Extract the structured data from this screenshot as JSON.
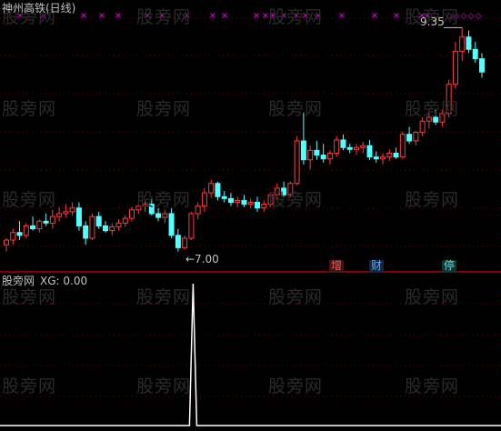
{
  "upper_panel": {
    "title": "神州高铁(日线)",
    "high_label": "9.35",
    "low_label": "←7.00",
    "tags": [
      {
        "text": "增",
        "color": "#ff5555",
        "bg": "#3a1818"
      },
      {
        "text": "财",
        "color": "#55aaff",
        "bg": "#14243a"
      },
      {
        "text": "停",
        "color": "#55dddd",
        "bg": "#113333"
      }
    ],
    "x_marker_glyph": "×",
    "diamond_glyph": "◇"
  },
  "lower_panel": {
    "name": "股旁网",
    "indicator": "XG: 0.00",
    "peak_value": 1
  },
  "watermark": "股旁网",
  "colors": {
    "up": "#ff3c3c",
    "down": "#54ffff",
    "grid": "#7a0000",
    "divider": "#b00000",
    "marker": "#ff00ff",
    "text": "#c0c0c0",
    "peak_line": "#ffffff"
  },
  "chart_data": {
    "type": "candlestick",
    "price_range": [
      6.85,
      9.45
    ],
    "candles": [
      {
        "o": 7.05,
        "h": 7.12,
        "l": 6.98,
        "c": 7.1
      },
      {
        "o": 7.1,
        "h": 7.22,
        "l": 7.05,
        "c": 7.18
      },
      {
        "o": 7.18,
        "h": 7.3,
        "l": 7.1,
        "c": 7.15
      },
      {
        "o": 7.15,
        "h": 7.28,
        "l": 7.12,
        "c": 7.25
      },
      {
        "o": 7.25,
        "h": 7.35,
        "l": 7.2,
        "c": 7.22
      },
      {
        "o": 7.22,
        "h": 7.32,
        "l": 7.18,
        "c": 7.3
      },
      {
        "o": 7.3,
        "h": 7.38,
        "l": 7.25,
        "c": 7.28
      },
      {
        "o": 7.28,
        "h": 7.42,
        "l": 7.22,
        "c": 7.35
      },
      {
        "o": 7.35,
        "h": 7.45,
        "l": 7.3,
        "c": 7.38
      },
      {
        "o": 7.38,
        "h": 7.48,
        "l": 7.34,
        "c": 7.4
      },
      {
        "o": 7.4,
        "h": 7.5,
        "l": 7.36,
        "c": 7.44
      },
      {
        "o": 7.44,
        "h": 7.5,
        "l": 7.2,
        "c": 7.25
      },
      {
        "o": 7.25,
        "h": 7.3,
        "l": 7.05,
        "c": 7.12
      },
      {
        "o": 7.12,
        "h": 7.38,
        "l": 7.1,
        "c": 7.35
      },
      {
        "o": 7.35,
        "h": 7.4,
        "l": 7.22,
        "c": 7.25
      },
      {
        "o": 7.25,
        "h": 7.3,
        "l": 7.18,
        "c": 7.2
      },
      {
        "o": 7.2,
        "h": 7.28,
        "l": 7.15,
        "c": 7.24
      },
      {
        "o": 7.24,
        "h": 7.32,
        "l": 7.2,
        "c": 7.28
      },
      {
        "o": 7.28,
        "h": 7.36,
        "l": 7.24,
        "c": 7.33
      },
      {
        "o": 7.33,
        "h": 7.45,
        "l": 7.3,
        "c": 7.42
      },
      {
        "o": 7.42,
        "h": 7.5,
        "l": 7.38,
        "c": 7.46
      },
      {
        "o": 7.46,
        "h": 7.52,
        "l": 7.4,
        "c": 7.48
      },
      {
        "o": 7.48,
        "h": 7.54,
        "l": 7.36,
        "c": 7.38
      },
      {
        "o": 7.38,
        "h": 7.44,
        "l": 7.3,
        "c": 7.34
      },
      {
        "o": 7.34,
        "h": 7.42,
        "l": 7.28,
        "c": 7.38
      },
      {
        "o": 7.38,
        "h": 7.44,
        "l": 7.12,
        "c": 7.15
      },
      {
        "o": 7.15,
        "h": 7.22,
        "l": 6.98,
        "c": 7.02
      },
      {
        "o": 7.02,
        "h": 7.15,
        "l": 7.0,
        "c": 7.12
      },
      {
        "o": 7.12,
        "h": 7.4,
        "l": 7.1,
        "c": 7.38
      },
      {
        "o": 7.38,
        "h": 7.5,
        "l": 7.32,
        "c": 7.46
      },
      {
        "o": 7.46,
        "h": 7.65,
        "l": 7.4,
        "c": 7.6
      },
      {
        "o": 7.6,
        "h": 7.74,
        "l": 7.55,
        "c": 7.7
      },
      {
        "o": 7.7,
        "h": 7.72,
        "l": 7.52,
        "c": 7.56
      },
      {
        "o": 7.56,
        "h": 7.62,
        "l": 7.5,
        "c": 7.54
      },
      {
        "o": 7.54,
        "h": 7.6,
        "l": 7.46,
        "c": 7.5
      },
      {
        "o": 7.5,
        "h": 7.56,
        "l": 7.45,
        "c": 7.52
      },
      {
        "o": 7.52,
        "h": 7.58,
        "l": 7.45,
        "c": 7.48
      },
      {
        "o": 7.48,
        "h": 7.54,
        "l": 7.44,
        "c": 7.5
      },
      {
        "o": 7.5,
        "h": 7.56,
        "l": 7.4,
        "c": 7.44
      },
      {
        "o": 7.44,
        "h": 7.52,
        "l": 7.4,
        "c": 7.48
      },
      {
        "o": 7.48,
        "h": 7.6,
        "l": 7.45,
        "c": 7.58
      },
      {
        "o": 7.58,
        "h": 7.7,
        "l": 7.52,
        "c": 7.65
      },
      {
        "o": 7.65,
        "h": 7.72,
        "l": 7.55,
        "c": 7.58
      },
      {
        "o": 7.58,
        "h": 7.72,
        "l": 7.55,
        "c": 7.7
      },
      {
        "o": 7.7,
        "h": 8.2,
        "l": 7.68,
        "c": 8.15
      },
      {
        "o": 8.15,
        "h": 8.45,
        "l": 7.9,
        "c": 7.95
      },
      {
        "o": 7.95,
        "h": 8.1,
        "l": 7.85,
        "c": 8.05
      },
      {
        "o": 8.05,
        "h": 8.15,
        "l": 7.95,
        "c": 8.0
      },
      {
        "o": 8.0,
        "h": 8.12,
        "l": 7.92,
        "c": 7.96
      },
      {
        "o": 7.96,
        "h": 8.05,
        "l": 7.9,
        "c": 8.02
      },
      {
        "o": 8.02,
        "h": 8.2,
        "l": 7.98,
        "c": 8.16
      },
      {
        "o": 8.16,
        "h": 8.22,
        "l": 8.05,
        "c": 8.08
      },
      {
        "o": 8.08,
        "h": 8.12,
        "l": 8.02,
        "c": 8.06
      },
      {
        "o": 8.06,
        "h": 8.12,
        "l": 8.0,
        "c": 8.08
      },
      {
        "o": 8.08,
        "h": 8.14,
        "l": 8.02,
        "c": 8.1
      },
      {
        "o": 8.1,
        "h": 8.16,
        "l": 7.95,
        "c": 7.98
      },
      {
        "o": 7.98,
        "h": 8.04,
        "l": 7.92,
        "c": 7.96
      },
      {
        "o": 7.96,
        "h": 8.02,
        "l": 7.9,
        "c": 7.98
      },
      {
        "o": 7.98,
        "h": 8.06,
        "l": 7.94,
        "c": 8.02
      },
      {
        "o": 8.02,
        "h": 8.08,
        "l": 7.96,
        "c": 7.98
      },
      {
        "o": 7.98,
        "h": 8.25,
        "l": 7.96,
        "c": 8.22
      },
      {
        "o": 8.22,
        "h": 8.3,
        "l": 8.12,
        "c": 8.15
      },
      {
        "o": 8.15,
        "h": 8.26,
        "l": 8.1,
        "c": 8.24
      },
      {
        "o": 8.24,
        "h": 8.4,
        "l": 8.2,
        "c": 8.36
      },
      {
        "o": 8.36,
        "h": 8.45,
        "l": 8.28,
        "c": 8.4
      },
      {
        "o": 8.4,
        "h": 8.48,
        "l": 8.32,
        "c": 8.35
      },
      {
        "o": 8.35,
        "h": 8.48,
        "l": 8.3,
        "c": 8.44
      },
      {
        "o": 8.44,
        "h": 8.8,
        "l": 8.4,
        "c": 8.75
      },
      {
        "o": 8.75,
        "h": 9.2,
        "l": 8.7,
        "c": 9.1
      },
      {
        "o": 9.1,
        "h": 9.35,
        "l": 9.0,
        "c": 9.25
      },
      {
        "o": 9.25,
        "h": 9.32,
        "l": 9.08,
        "c": 9.12
      },
      {
        "o": 9.12,
        "h": 9.2,
        "l": 8.98,
        "c": 9.02
      },
      {
        "o": 9.02,
        "h": 9.08,
        "l": 8.82,
        "c": 8.88
      }
    ],
    "xg_values_note_free": true,
    "xg_peak_candle_index": 28
  }
}
